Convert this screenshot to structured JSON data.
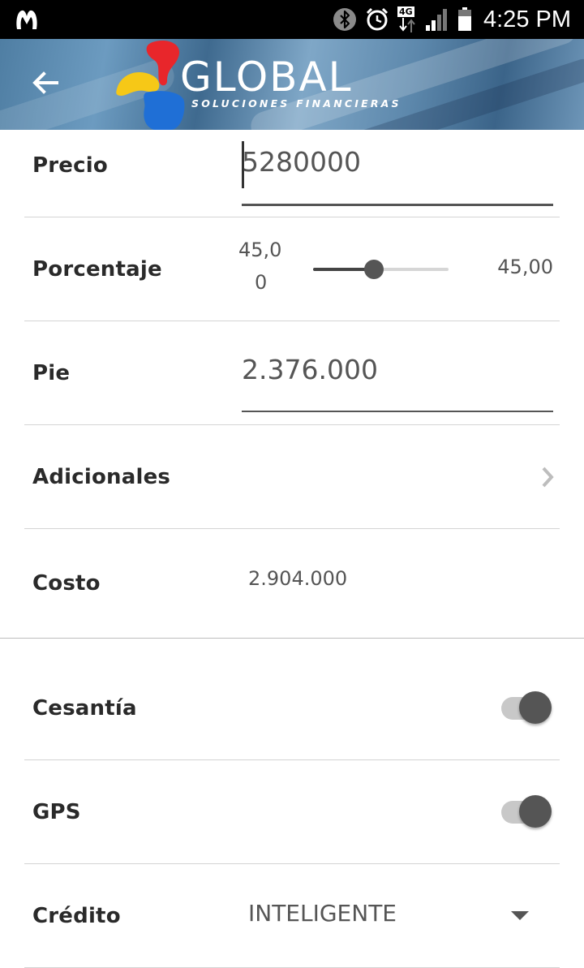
{
  "status_bar": {
    "network_badge": "4G",
    "time": "4:25 PM"
  },
  "header": {
    "brand": "GLOBAL",
    "tagline": "SOLUCIONES FINANCIERAS"
  },
  "form": {
    "precio": {
      "label": "Precio",
      "value": "5280000"
    },
    "porcentaje": {
      "label": "Porcentaje",
      "min_value_line1": "45,0",
      "min_value_line2": "0",
      "value": "45,00",
      "slider_level": 0.45
    },
    "pie": {
      "label": "Pie",
      "value": "2.376.000"
    },
    "adicionales": {
      "label": "Adicionales"
    },
    "costo": {
      "label": "Costo",
      "value": "2.904.000"
    },
    "cesantia": {
      "label": "Cesantía",
      "enabled": true
    },
    "gps": {
      "label": "GPS",
      "enabled": true
    },
    "credito": {
      "label": "Crédito",
      "value": "INTELIGENTE"
    }
  },
  "colors": {
    "status_bar_bg": "#000000",
    "header_bg": "#5d88ac",
    "logo_red": "#e8262b",
    "logo_yellow": "#f6c817",
    "logo_blue": "#1f6fd6",
    "control_dark": "#555555",
    "toggle_track": "#c8c8c8"
  }
}
